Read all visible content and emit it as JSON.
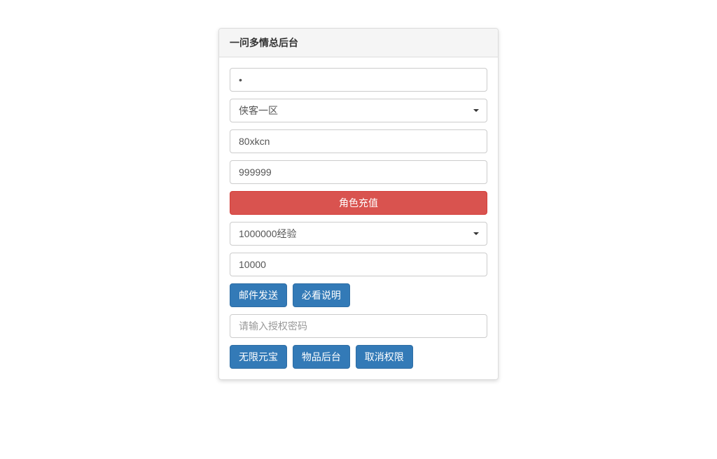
{
  "panel": {
    "title": "一问多情总后台"
  },
  "fields": {
    "password_value": "•",
    "server_selected": "侠客一区",
    "account_value": "80xkcn",
    "amount_value": "999999",
    "type_selected": "1000000经验",
    "qty_value": "10000",
    "auth_placeholder": "请输入授权密码"
  },
  "buttons": {
    "recharge": "角色充值",
    "send_mail": "邮件发送",
    "must_read": "必看说明",
    "unlimited_gold": "无限元宝",
    "item_backend": "物品后台",
    "cancel_perm": "取消权限"
  }
}
